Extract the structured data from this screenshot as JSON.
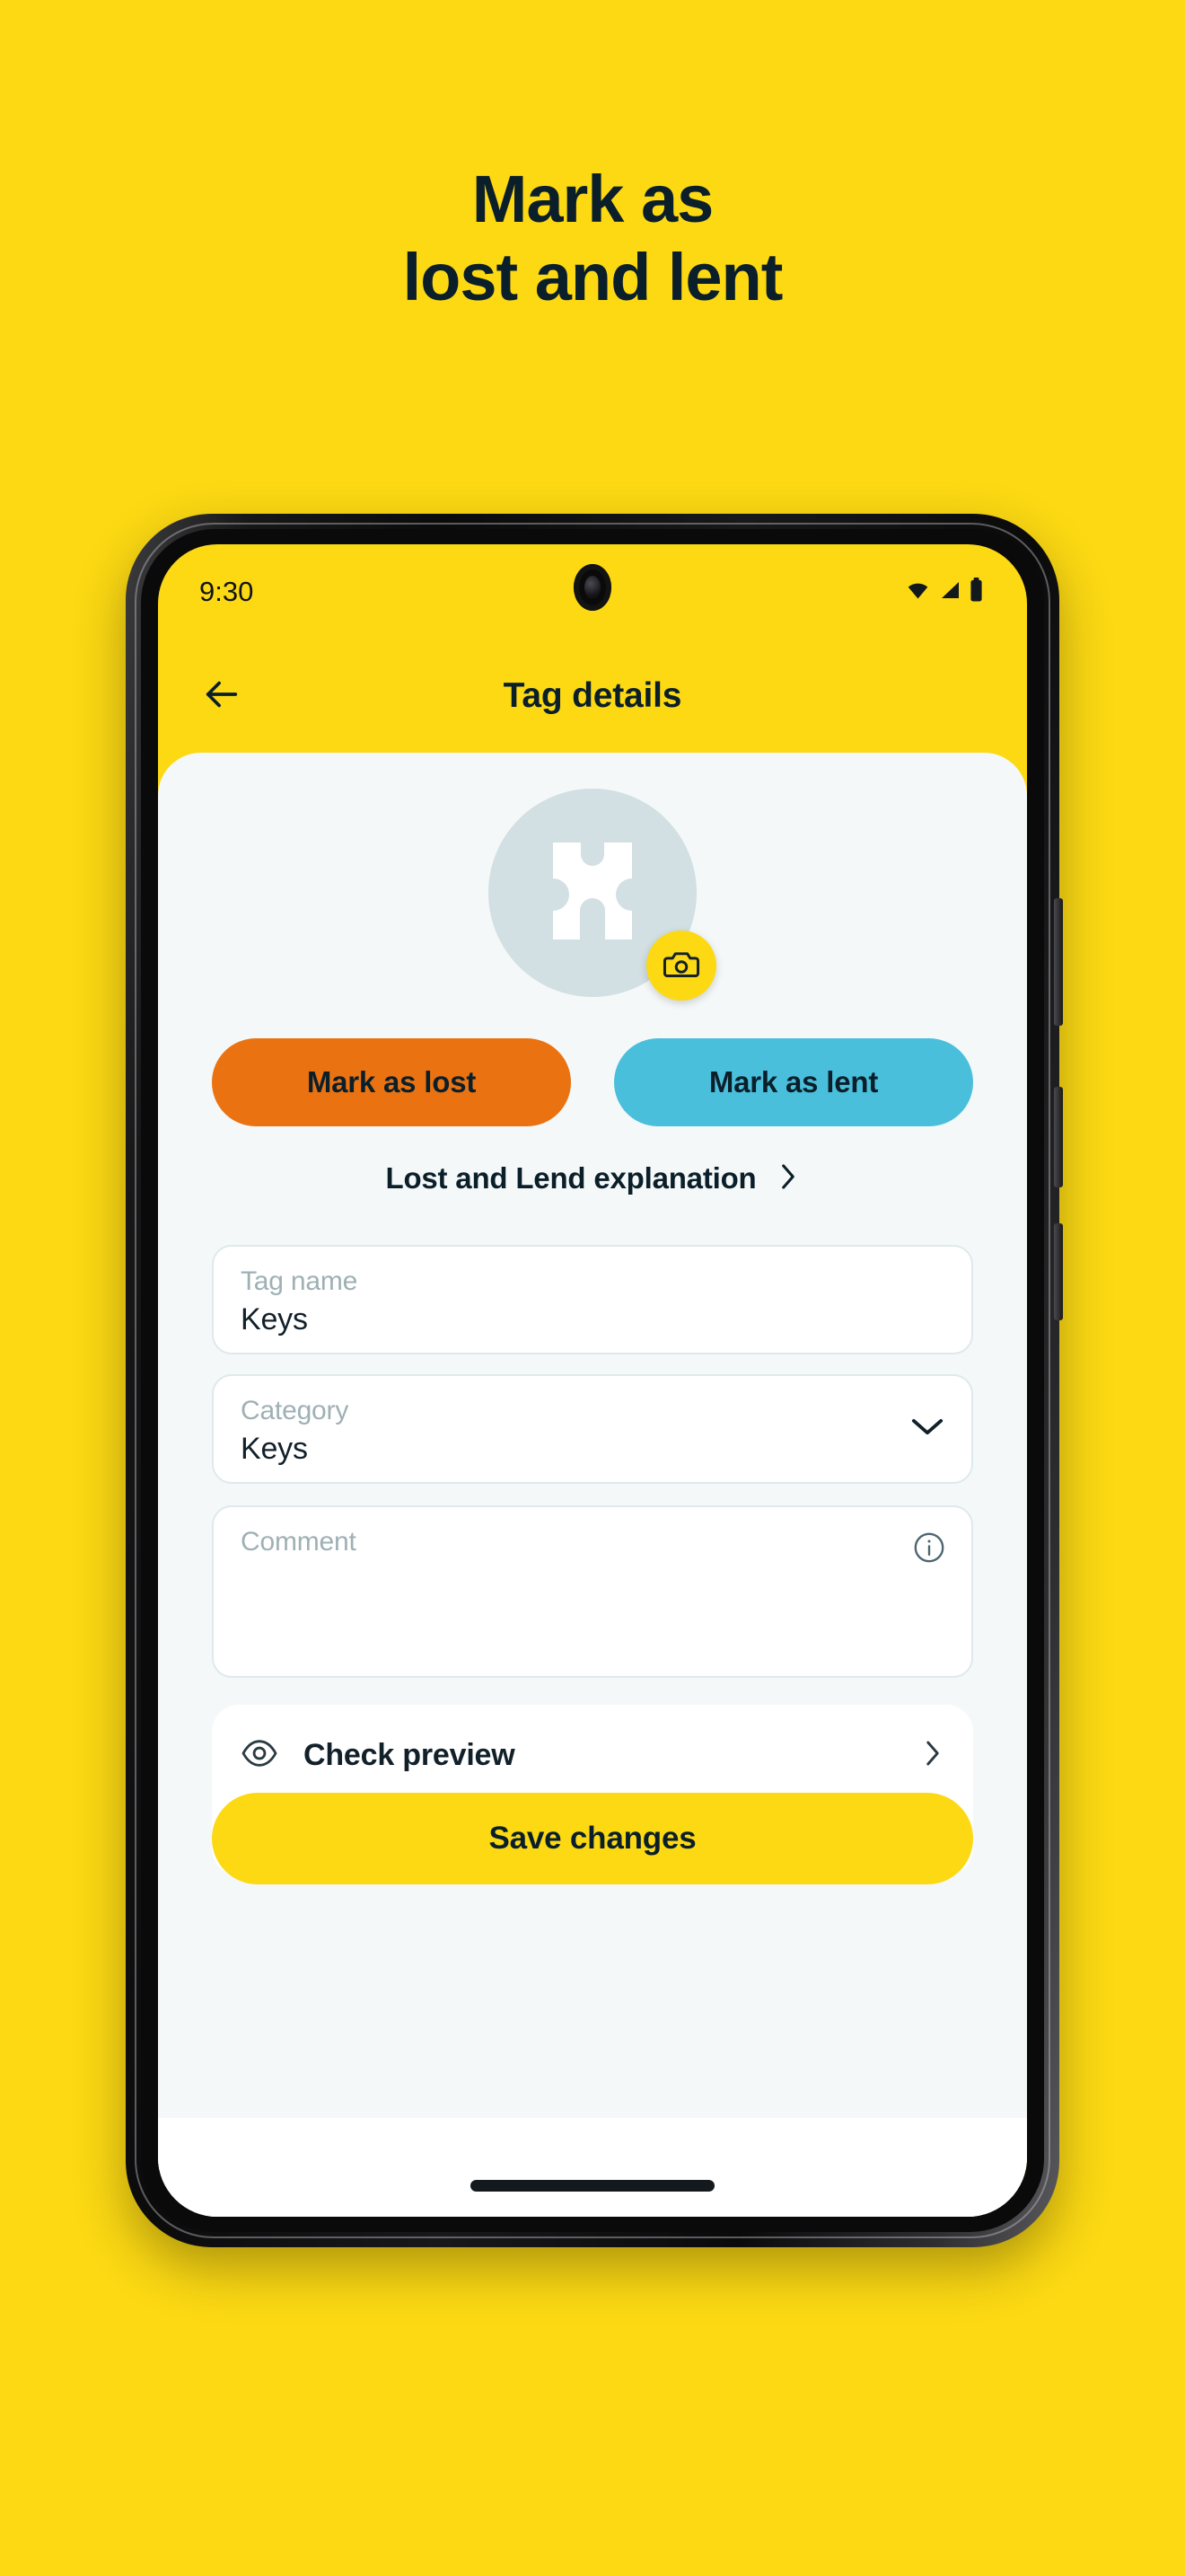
{
  "promo": {
    "line1": "Mark as",
    "line2": "lost and lent",
    "background_color": "#FCD913",
    "text_color": "#0B1F2A"
  },
  "phone": {
    "statusbar": {
      "time": "9:30",
      "icons": [
        "wifi-icon",
        "cellular-signal-icon",
        "battery-icon"
      ]
    },
    "home_indicator": "home-indicator"
  },
  "appbar": {
    "back_icon": "arrow-left-icon",
    "title": "Tag details"
  },
  "avatar": {
    "placeholder_icon": "tag-logo-icon",
    "circle_color": "#D2DFE3",
    "camera_button_icon": "camera-icon",
    "camera_button_color": "#FCD913"
  },
  "actions": {
    "mark_lost_label": "Mark as lost",
    "mark_lost_color": "#EA7211",
    "mark_lent_label": "Mark as lent",
    "mark_lent_color": "#4ABFDC",
    "explanation_label": "Lost and Lend explanation",
    "explanation_icon": "chevron-right-icon"
  },
  "form": {
    "tag_name": {
      "label": "Tag name",
      "value": "Keys",
      "placeholder": "Tag name"
    },
    "category": {
      "label": "Category",
      "value": "Keys",
      "placeholder": "Category",
      "icon": "chevron-down-icon"
    },
    "comment": {
      "label": "Comment",
      "value": "",
      "placeholder": "Comment",
      "icon": "info-icon"
    }
  },
  "bottom": {
    "preview_label": "Check preview",
    "preview_icon": "eye-icon",
    "preview_chevron": "chevron-right-icon",
    "save_label": "Save changes",
    "save_color": "#FCD913"
  }
}
